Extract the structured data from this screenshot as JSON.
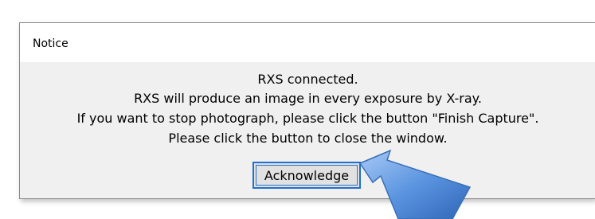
{
  "dialog": {
    "title": "Notice",
    "lines": [
      "RXS connected.",
      "RXS will produce an image  in every exposure by X-ray.",
      "If you want to stop photograph, please click the button \"Finish Capture\".",
      "Please click the button to close the window."
    ],
    "button_label": "Acknowledge"
  },
  "colors": {
    "dialog_background": "#f0f0f0",
    "titlebar_background": "#ffffff",
    "button_focus_border": "#1e6fd0",
    "annotation_arrow": "#5b95e0"
  },
  "annotation": {
    "icon": "pointer-arrow-icon"
  }
}
